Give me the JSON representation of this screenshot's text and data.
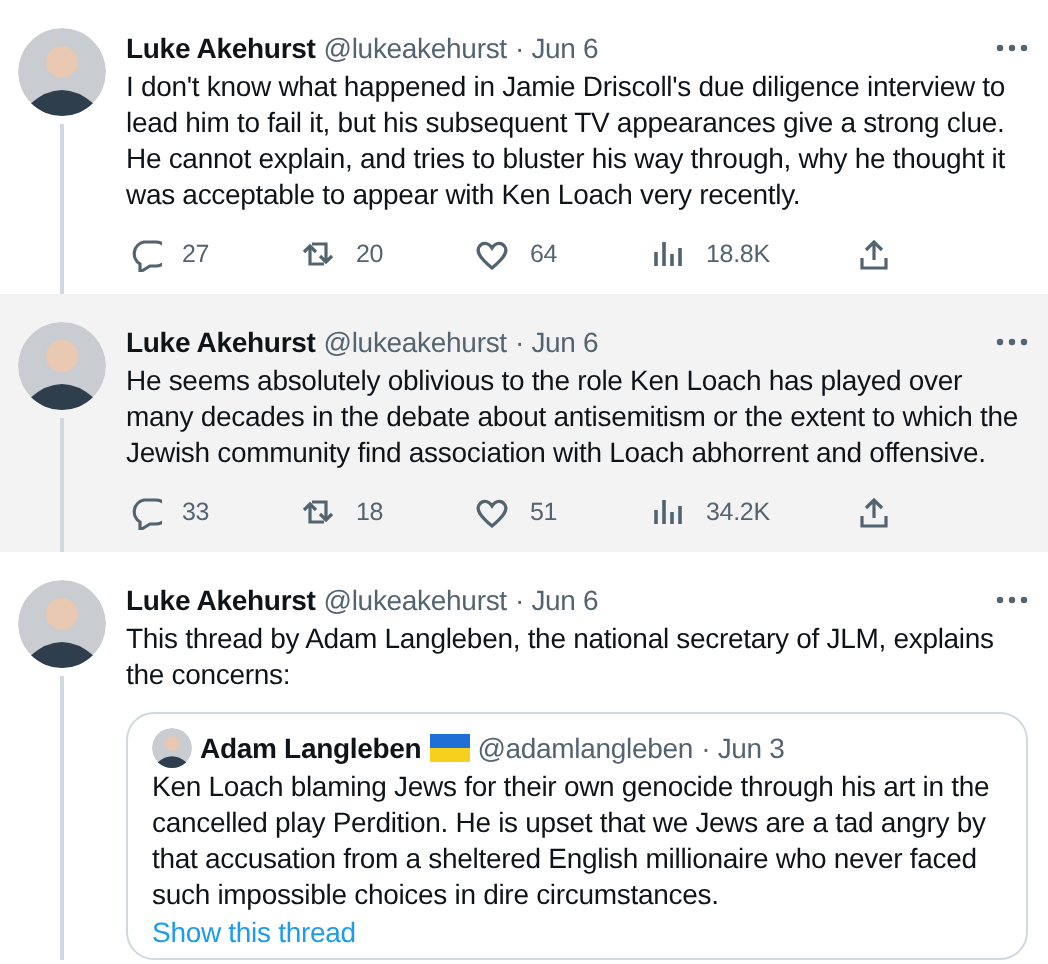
{
  "tweets": [
    {
      "name": "Luke Akehurst",
      "handle": "@lukeakehurst",
      "date": "· Jun 6",
      "highlighted": false,
      "text": "I don't know what happened in Jamie Driscoll's due diligence interview to lead him to fail it, but his subsequent TV appearances give a strong clue. He cannot explain, and tries to bluster his way through, why he thought it was acceptable to appear with Ken Loach very recently.",
      "stats": {
        "replies": "27",
        "retweets": "20",
        "likes": "64",
        "views": "18.8K"
      }
    },
    {
      "name": "Luke Akehurst",
      "handle": "@lukeakehurst",
      "date": "· Jun 6",
      "highlighted": true,
      "text": "He seems absolutely oblivious to the role Ken Loach has played over many decades in the debate about antisemitism or the extent to which the Jewish community find association with Loach abhorrent and offensive.",
      "stats": {
        "replies": "33",
        "retweets": "18",
        "likes": "51",
        "views": "34.2K"
      }
    },
    {
      "name": "Luke Akehurst",
      "handle": "@lukeakehurst",
      "date": "· Jun 6",
      "highlighted": false,
      "text": "This thread by Adam Langleben, the national secretary of JLM, explains the concerns:",
      "quote": {
        "name": "Adam Langleben",
        "handle": "@adamlangleben",
        "date": "· Jun 3",
        "text": "Ken Loach blaming Jews for their own genocide through his art in the cancelled play Perdition. He is upset that we Jews are a tad angry by that accusation from a sheltered English millionaire who never faced such impossible choices in dire circumstances.",
        "link": "Show this thread"
      }
    }
  ]
}
